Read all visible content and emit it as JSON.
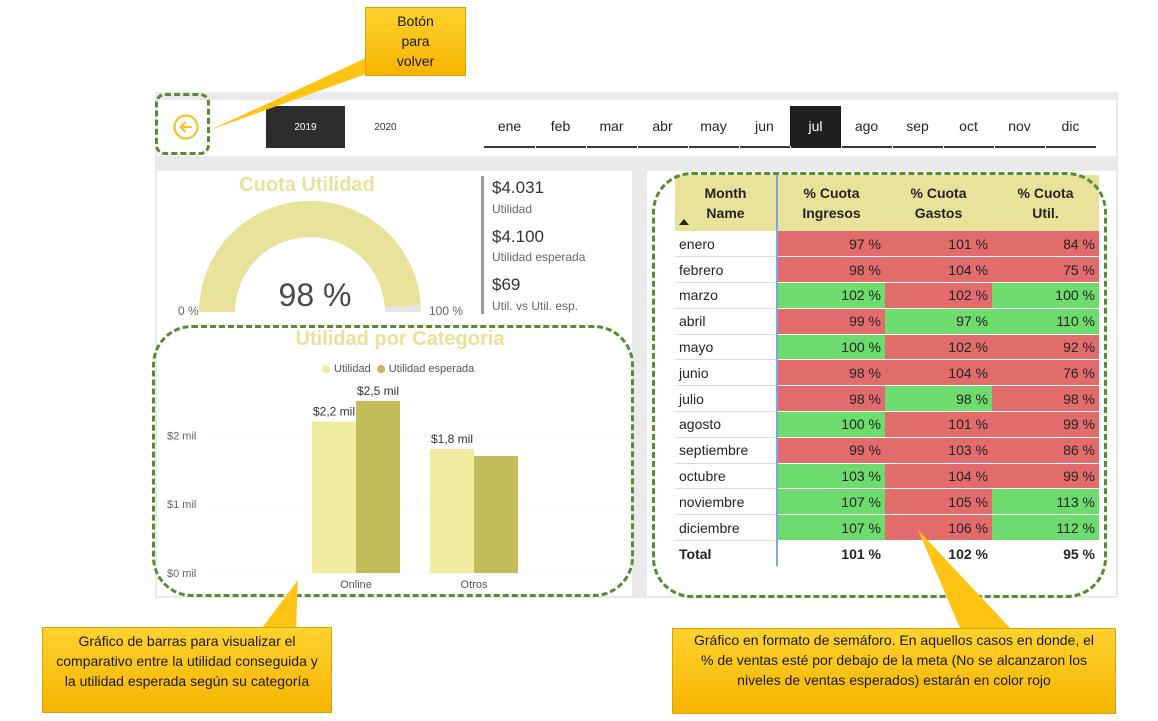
{
  "colors": {
    "gauge_fill": "#e8e29a",
    "bar_utilidad": "#f0eca0",
    "bar_esperada": "#c2bc5a",
    "cell_red": "#e26c6c",
    "cell_green": "#6ddb6d",
    "callout": "#ffc414",
    "dash": "#5a8a32"
  },
  "top_bar": {
    "back_icon": "arrow-left-circle-icon",
    "years": [
      "2019",
      "2020"
    ],
    "selected_year": "2019",
    "months": [
      "ene",
      "feb",
      "mar",
      "abr",
      "may",
      "jun",
      "jul",
      "ago",
      "sep",
      "oct",
      "nov",
      "dic"
    ],
    "selected_month": "jul"
  },
  "gauge": {
    "title": "Cuota Utilidad",
    "value_label": "98 %",
    "value": 0.98,
    "min_label": "0 %",
    "max_label": "100 %"
  },
  "kpis": [
    {
      "value": "$4.031",
      "label": "Utilidad"
    },
    {
      "value": "$4.100",
      "label": "Utilidad esperada"
    },
    {
      "value": "$69",
      "label": "Util. vs Util. esp."
    }
  ],
  "chart_data": {
    "type": "bar",
    "title": "Utilidad por Categoria",
    "categories": [
      "Online",
      "Otros"
    ],
    "series": [
      {
        "name": "Utilidad",
        "values": [
          2.2,
          1.8
        ]
      },
      {
        "name": "Utilidad esperada",
        "values": [
          2.5,
          1.7
        ]
      }
    ],
    "data_labels": [
      [
        "$2,2 mil",
        "$1,8 mil"
      ],
      [
        "$2,5 mil",
        ""
      ]
    ],
    "y_ticks": [
      0,
      1,
      2
    ],
    "y_tick_labels": [
      "$0 mil",
      "$1 mil",
      "$2 mil"
    ],
    "ylim": [
      0,
      2.6
    ],
    "legend_position": "top",
    "grid": true
  },
  "table": {
    "headers": [
      "Month\nName",
      "% Cuota\nIngresos",
      "% Cuota\nGastos",
      "% Cuota\nUtil."
    ],
    "rows": [
      {
        "name": "enero",
        "cells": [
          {
            "v": "97 %",
            "c": "red"
          },
          {
            "v": "101 %",
            "c": "red"
          },
          {
            "v": "84 %",
            "c": "red"
          }
        ]
      },
      {
        "name": "febrero",
        "cells": [
          {
            "v": "98 %",
            "c": "red"
          },
          {
            "v": "104 %",
            "c": "red"
          },
          {
            "v": "75 %",
            "c": "red"
          }
        ]
      },
      {
        "name": "marzo",
        "cells": [
          {
            "v": "102 %",
            "c": "green"
          },
          {
            "v": "102 %",
            "c": "red"
          },
          {
            "v": "100 %",
            "c": "green"
          }
        ]
      },
      {
        "name": "abril",
        "cells": [
          {
            "v": "99 %",
            "c": "red"
          },
          {
            "v": "97 %",
            "c": "green"
          },
          {
            "v": "110 %",
            "c": "green"
          }
        ]
      },
      {
        "name": "mayo",
        "cells": [
          {
            "v": "100 %",
            "c": "green"
          },
          {
            "v": "102 %",
            "c": "red"
          },
          {
            "v": "92 %",
            "c": "red"
          }
        ]
      },
      {
        "name": "junio",
        "cells": [
          {
            "v": "98 %",
            "c": "red"
          },
          {
            "v": "104 %",
            "c": "red"
          },
          {
            "v": "76 %",
            "c": "red"
          }
        ]
      },
      {
        "name": "julio",
        "cells": [
          {
            "v": "98 %",
            "c": "red"
          },
          {
            "v": "98 %",
            "c": "green"
          },
          {
            "v": "98 %",
            "c": "red"
          }
        ]
      },
      {
        "name": "agosto",
        "cells": [
          {
            "v": "100 %",
            "c": "green"
          },
          {
            "v": "101 %",
            "c": "red"
          },
          {
            "v": "99 %",
            "c": "red"
          }
        ]
      },
      {
        "name": "septiembre",
        "cells": [
          {
            "v": "99 %",
            "c": "red"
          },
          {
            "v": "103 %",
            "c": "red"
          },
          {
            "v": "86 %",
            "c": "red"
          }
        ]
      },
      {
        "name": "octubre",
        "cells": [
          {
            "v": "103 %",
            "c": "green"
          },
          {
            "v": "104 %",
            "c": "red"
          },
          {
            "v": "99 %",
            "c": "red"
          }
        ]
      },
      {
        "name": "noviembre",
        "cells": [
          {
            "v": "107 %",
            "c": "green"
          },
          {
            "v": "105 %",
            "c": "red"
          },
          {
            "v": "113 %",
            "c": "green"
          }
        ]
      },
      {
        "name": "diciembre",
        "cells": [
          {
            "v": "107 %",
            "c": "green"
          },
          {
            "v": "106 %",
            "c": "red"
          },
          {
            "v": "112 %",
            "c": "green"
          }
        ]
      }
    ],
    "total": {
      "name": "Total",
      "cells": [
        "101 %",
        "102 %",
        "95 %"
      ]
    }
  },
  "callouts": {
    "back": "Botón\npara\nvolver",
    "bar_chart": "Gráfico de barras para visualizar el comparativo entre la utilidad conseguida y la utilidad esperada según su categoría",
    "table": "Gráfico en formato de semáforo. En aquellos casos en donde, el % de ventas esté por debajo de la meta (No se alcanzaron los niveles de ventas esperados) estarán en color rojo"
  }
}
